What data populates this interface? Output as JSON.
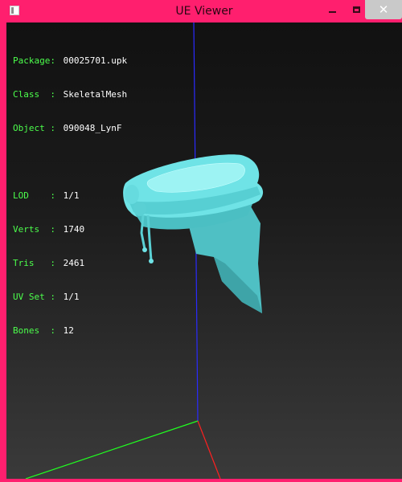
{
  "window": {
    "title": "UE Viewer",
    "minimize_symbol": "minimize-icon",
    "maximize_symbol": "maximize-icon",
    "close_symbol": "✕",
    "frame_color": "#ff1f6e"
  },
  "info": {
    "package": {
      "label": "Package:",
      "value": "00025701.upk"
    },
    "class": {
      "label": "Class  :",
      "value": "SkeletalMesh"
    },
    "object": {
      "label": "Object :",
      "value": "090048_LynF"
    },
    "lod": {
      "label": "LOD    :",
      "value": "1/1"
    },
    "verts": {
      "label": "Verts  :",
      "value": "1740"
    },
    "tris": {
      "label": "Tris   :",
      "value": "2461"
    },
    "uvset": {
      "label": "UV Set :",
      "value": "1/1"
    },
    "bones": {
      "label": "Bones  :",
      "value": "12"
    },
    "label_color": "#4cff4c",
    "value_color": "#ffffff"
  },
  "scene": {
    "mesh_color": "#6fe3e6",
    "axis_colors": {
      "x": "#ff2020",
      "y": "#20ff20",
      "z": "#2a2aff"
    }
  }
}
